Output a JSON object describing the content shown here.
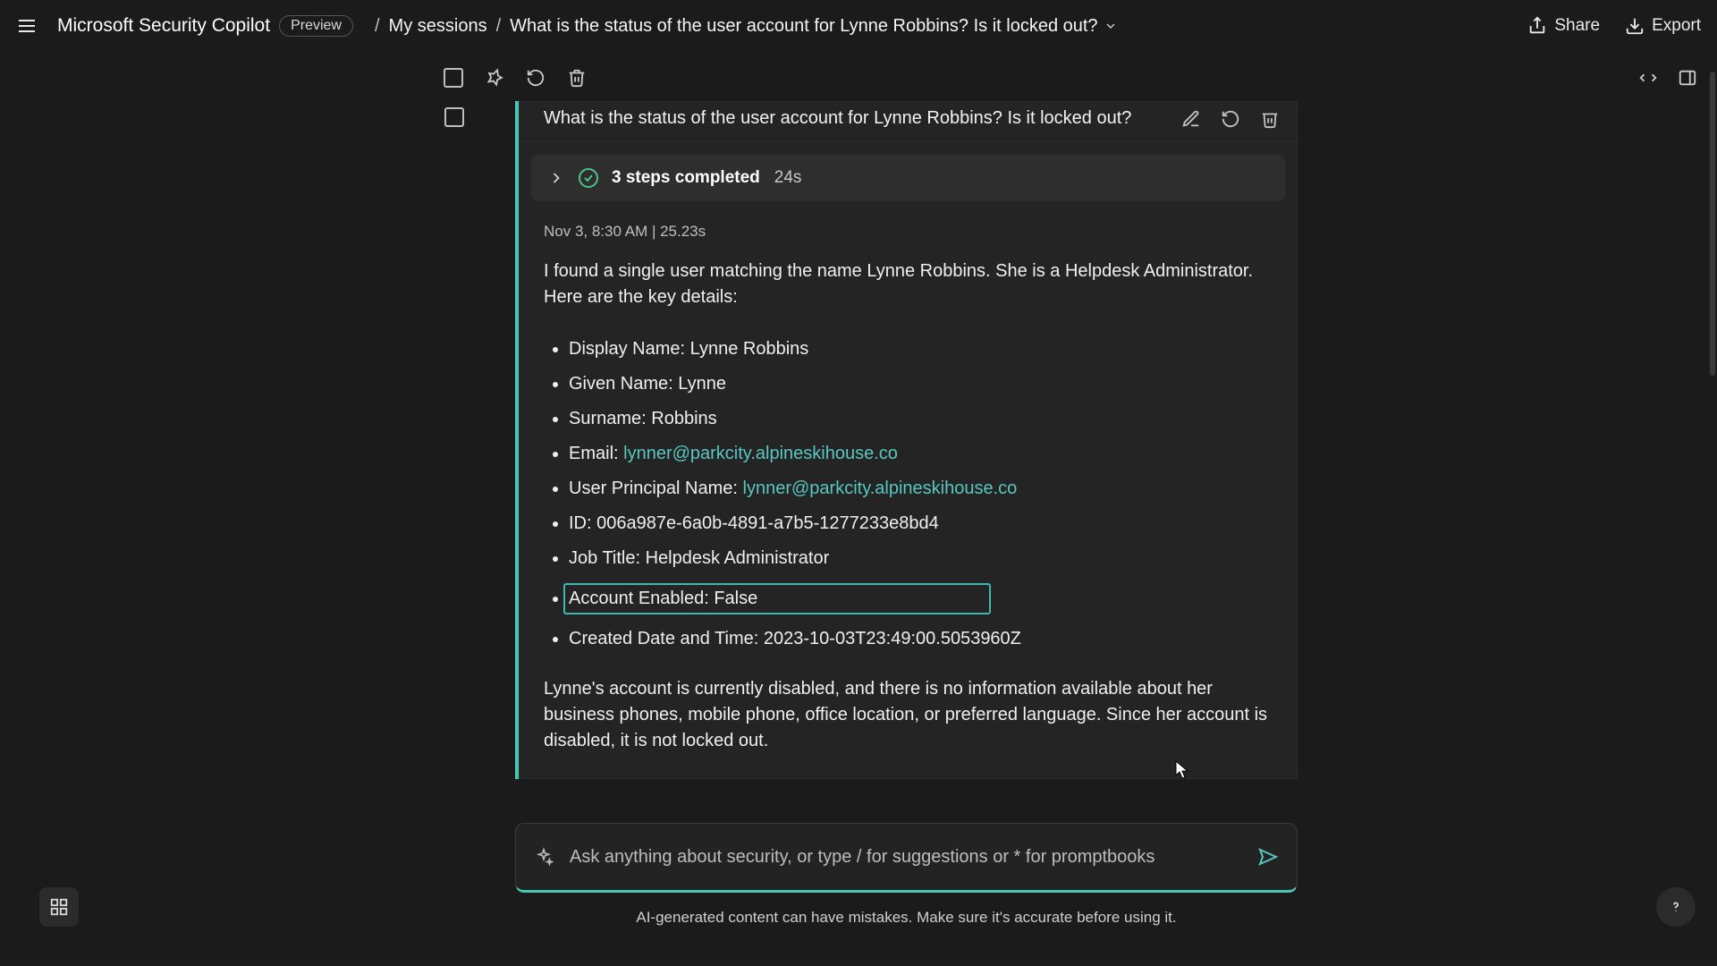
{
  "header": {
    "app_title": "Microsoft Security Copilot",
    "preview_badge": "Preview",
    "crumb1": "My sessions",
    "crumb2": "What is the status of the user account for Lynne Robbins? Is it locked out?",
    "share": "Share",
    "export": "Export"
  },
  "card": {
    "title": "What is the status of the user account for Lynne Robbins? Is it locked out?",
    "steps_label": "3 steps completed",
    "steps_duration": "24s",
    "meta": "Nov 3, 8:30 AM  |  25.23s",
    "intro": "I found a single user matching the name Lynne Robbins. She is a Helpdesk Administrator. Here are the key details:",
    "details": {
      "display_name_label": "Display Name: ",
      "display_name_value": "Lynne Robbins",
      "given_name_label": "Given Name: ",
      "given_name_value": "Lynne",
      "surname_label": "Surname: ",
      "surname_value": "Robbins",
      "email_label": "Email: ",
      "email_value": "lynner@parkcity.alpineskihouse.co",
      "upn_label": "User Principal Name: ",
      "upn_value": "lynner@parkcity.alpineskihouse.co",
      "id_label": "ID: ",
      "id_value": "006a987e-6a0b-4891-a7b5-1277233e8bd4",
      "job_label": "Job Title: ",
      "job_value": "Helpdesk Administrator",
      "enabled_label": "Account Enabled: ",
      "enabled_value": "False",
      "created_label": "Created Date and Time: ",
      "created_value": "2023-10-03T23:49:00.5053960Z"
    },
    "closing": "Lynne's account is currently disabled, and there is no information available about her business phones, mobile phone, office location, or preferred language. Since her account is disabled, it is not locked out."
  },
  "prompt": {
    "placeholder": "Ask anything about security, or type / for suggestions or * for promptbooks"
  },
  "footer": {
    "disclaimer": "AI-generated content can have mistakes. Make sure it's accurate before using it."
  }
}
